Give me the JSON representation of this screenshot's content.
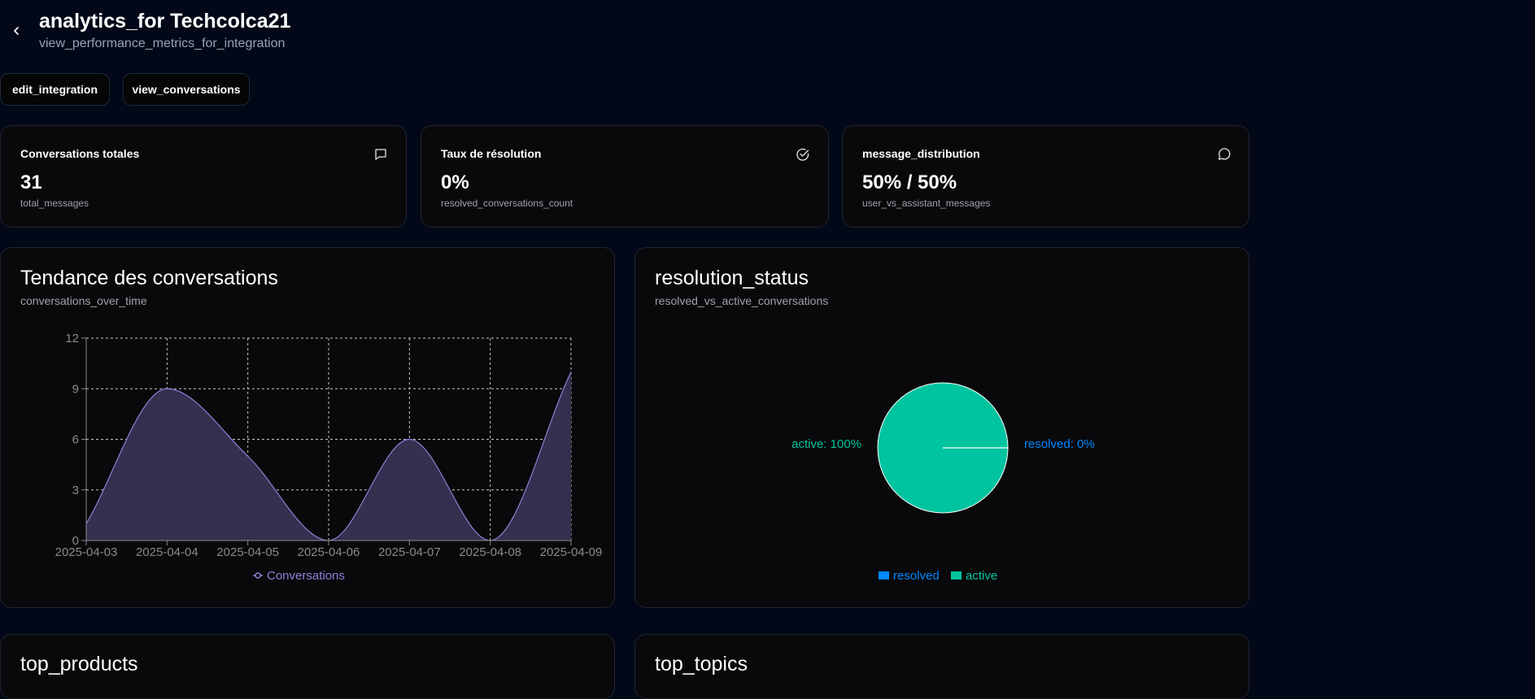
{
  "header": {
    "title": "analytics_for Techcolca21",
    "subtitle": "view_performance_metrics_for_integration"
  },
  "actions": {
    "edit_label": "edit_integration",
    "conversations_label": "view_conversations"
  },
  "stats": [
    {
      "label": "Conversations totales",
      "value": "31",
      "sub": "total_messages",
      "icon": "message-square-icon"
    },
    {
      "label": "Taux de résolution",
      "value": "0%",
      "sub": "resolved_conversations_count",
      "icon": "check-circle-icon"
    },
    {
      "label": "message_distribution",
      "value": "50% / 50%",
      "sub": "user_vs_assistant_messages",
      "icon": "message-circle-icon"
    }
  ],
  "trend": {
    "title": "Tendance des conversations",
    "subtitle": "conversations_over_time"
  },
  "resolution": {
    "title": "resolution_status",
    "subtitle": "resolved_vs_active_conversations"
  },
  "bottom": {
    "left_title": "top_products",
    "right_title": "top_topics"
  },
  "colors": {
    "background": "#020817",
    "line": "#8884d8",
    "area": "#34304f",
    "active": "#00c49f",
    "resolved": "#0088fe"
  },
  "chart_data": [
    {
      "type": "area",
      "x": [
        "2025-04-03",
        "2025-04-04",
        "2025-04-05",
        "2025-04-06",
        "2025-04-07",
        "2025-04-08",
        "2025-04-09"
      ],
      "series": [
        {
          "name": "Conversations",
          "values": [
            1,
            9,
            5,
            0,
            6,
            0,
            10
          ]
        }
      ],
      "yticks": [
        "0",
        "3",
        "6",
        "9",
        "12"
      ],
      "ylim": [
        0,
        12
      ],
      "grid": true,
      "legend": "bottom"
    },
    {
      "type": "pie",
      "slices": [
        {
          "name": "resolved",
          "value": 0,
          "label": "resolved: 0%"
        },
        {
          "name": "active",
          "value": 100,
          "label": "active: 100%"
        }
      ],
      "legend": "bottom"
    }
  ]
}
